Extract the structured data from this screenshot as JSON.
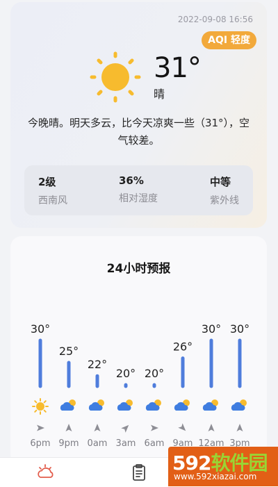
{
  "current": {
    "timestamp": "2022-09-08 16:56",
    "aqi_label": "AQI 轻度",
    "temperature": "31°",
    "condition": "晴",
    "summary": "今晚晴。明天多云，比今天凉爽一些（31°），空气较差。",
    "stats": [
      {
        "value": "2级",
        "label": "西南风"
      },
      {
        "value": "36%",
        "label": "相对湿度"
      },
      {
        "value": "中等",
        "label": "紫外线"
      }
    ]
  },
  "forecast": {
    "title": "24小时预报",
    "colors": {
      "bar": "#4f7ddc",
      "sun": "#f7bb2e",
      "cloud": "#3f7de0",
      "arrow": "#8e8e95"
    },
    "chart_data": {
      "type": "bar",
      "categories": [
        "6pm",
        "9pm",
        "0am",
        "3am",
        "6am",
        "9am",
        "12am",
        "3pm"
      ],
      "values": [
        30,
        25,
        22,
        20,
        20,
        26,
        30,
        30
      ],
      "value_labels": [
        "30°",
        "25°",
        "22°",
        "20°",
        "20°",
        "26°",
        "30°",
        "30°"
      ],
      "icons": [
        "sunny-icon",
        "partly-cloudy-icon",
        "partly-cloudy-icon",
        "partly-cloudy-icon",
        "partly-cloudy-icon",
        "partly-cloudy-icon",
        "partly-cloudy-icon",
        "partly-cloudy-icon"
      ],
      "wind_direction_deg": [
        90,
        0,
        0,
        45,
        90,
        135,
        0,
        0
      ],
      "ylim": [
        20,
        30
      ]
    }
  },
  "tabs": [
    "weather-tab",
    "clipboard-tab"
  ],
  "watermark": {
    "logo_digits": "592",
    "logo_text": "软件园",
    "site": "www.592xiazai.com"
  }
}
